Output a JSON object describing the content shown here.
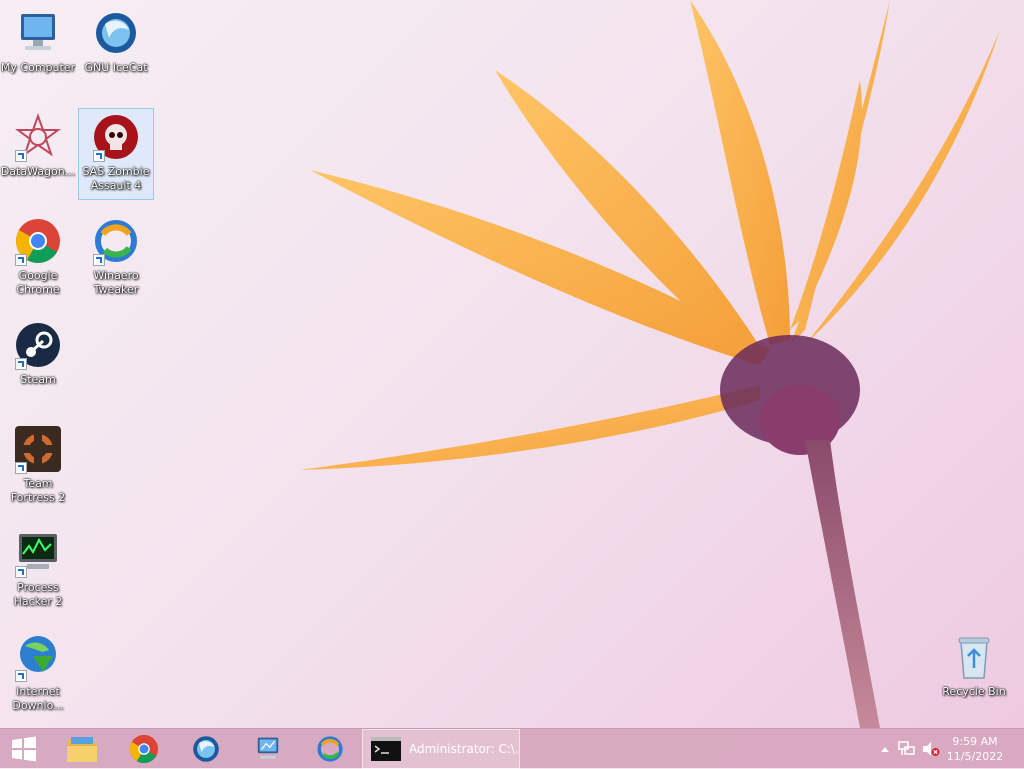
{
  "desktop": {
    "icons": [
      {
        "label": "My Computer",
        "icon": "computer-icon"
      },
      {
        "label": "GNU IceCat",
        "icon": "icecat-icon"
      },
      {
        "label": "DataWagon...",
        "icon": "datawagon-icon"
      },
      {
        "label": "SAS Zombie Assault 4",
        "icon": "zombie-skull-icon"
      },
      {
        "label": "Google Chrome",
        "icon": "chrome-icon"
      },
      {
        "label": "Winaero Tweaker",
        "icon": "winaero-icon"
      },
      {
        "label": "Steam",
        "icon": "steam-icon"
      },
      {
        "label": "Team Fortress 2",
        "icon": "tf2-icon"
      },
      {
        "label": "Process Hacker 2",
        "icon": "process-hacker-icon"
      },
      {
        "label": "Internet Downlo...",
        "icon": "idm-icon"
      },
      {
        "label": "Recycle Bin",
        "icon": "recycle-bin-icon"
      }
    ]
  },
  "taskbar": {
    "pinned": [
      "file-explorer-icon",
      "chrome-icon",
      "icecat-icon",
      "my-computer-icon",
      "winaero-icon"
    ],
    "window_label": "Administrator: C:\\...",
    "clock": {
      "time": "9:59 AM",
      "date": "11/5/2022"
    }
  },
  "colors": {
    "taskbar": "#d6a8be",
    "selection": "#cce8ff"
  }
}
